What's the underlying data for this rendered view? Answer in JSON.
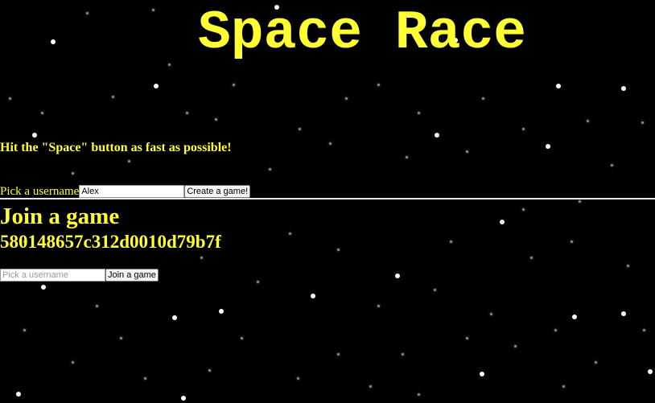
{
  "title": "Space Race",
  "tagline": "Hit the \"Space\" button as fast as possible!",
  "create_game": {
    "username_label": "Pick a username",
    "username_value": "Alex",
    "button_label": "Create a game!"
  },
  "join_game": {
    "heading": "Join a game",
    "games": [
      {
        "id": "580148657c312d0010d79b7f",
        "username_placeholder": "Pick a username",
        "username_value": "",
        "button_label": "Join a game"
      }
    ]
  },
  "colors": {
    "background": "#000000",
    "text": "#ffff33",
    "stars": "#ffffff"
  }
}
